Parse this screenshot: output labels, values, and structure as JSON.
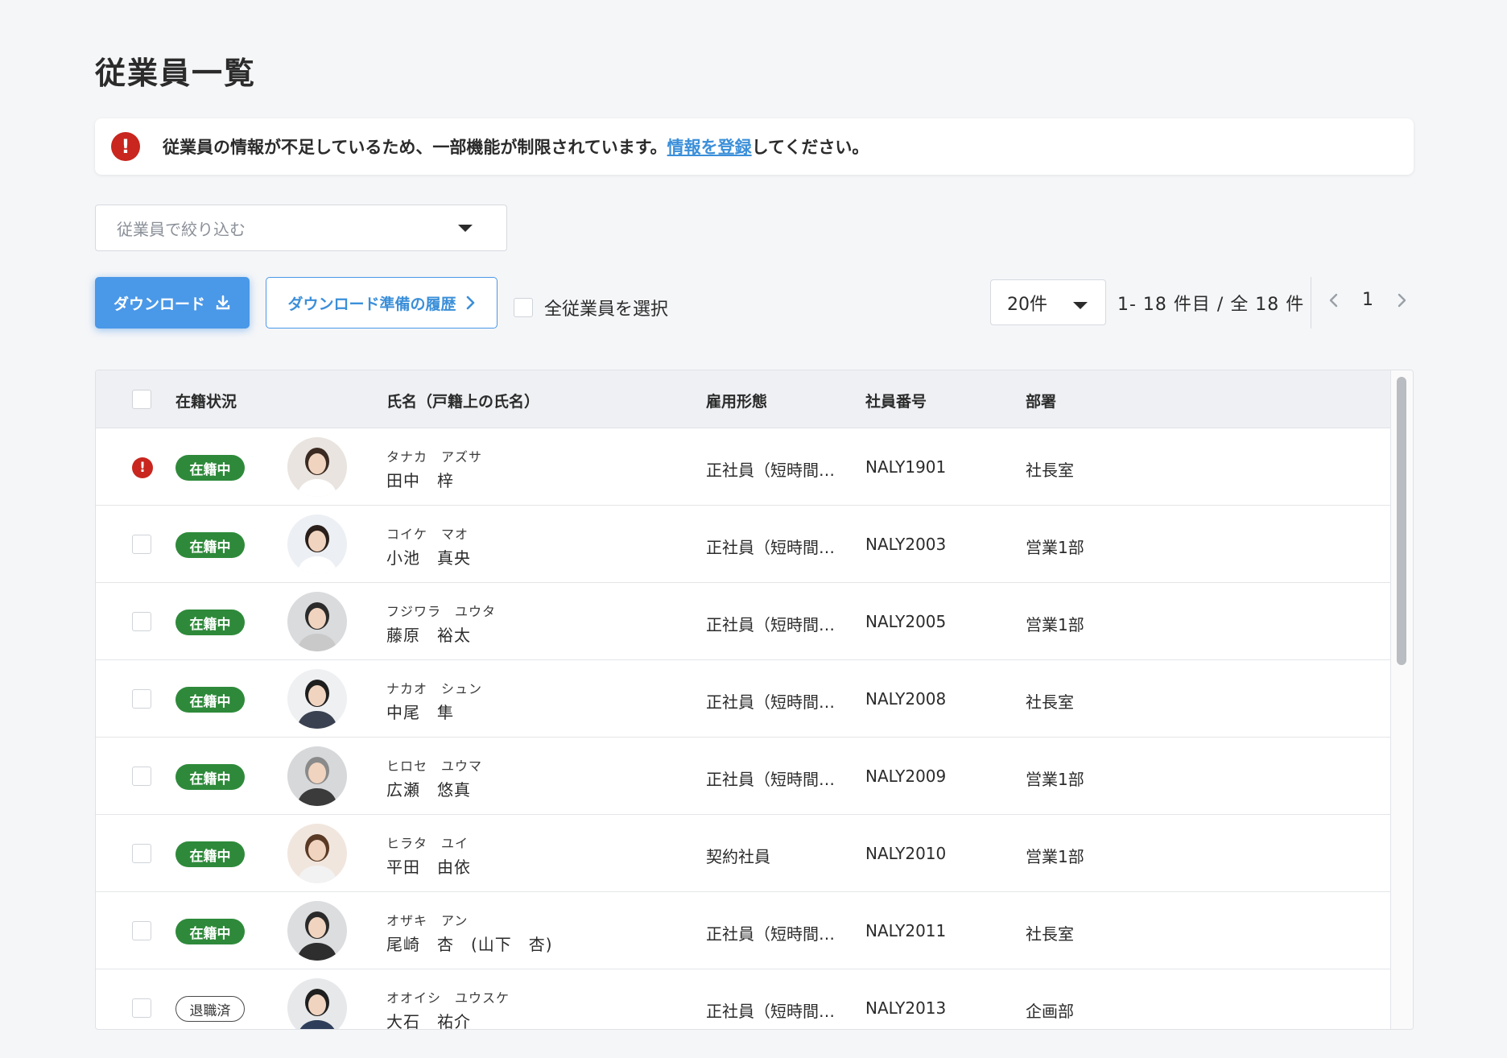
{
  "page_title": "従業員一覧",
  "alert": {
    "icon": "exclamation-icon",
    "text_before": "従業員の情報が不足しているため、一部機能が制限されています。",
    "link_text": "情報を登録",
    "text_after": "してください。"
  },
  "filter": {
    "placeholder": "従業員で絞り込む"
  },
  "toolbar": {
    "download_label": "ダウンロード",
    "history_label": "ダウンロード準備の履歴",
    "select_all_label": "全従業員を選択",
    "per_page": "20件",
    "range_text": "1- 18 件目 /  全 18 件",
    "current_page": "1"
  },
  "columns": {
    "status": "在籍状況",
    "name": "氏名（戸籍上の氏名）",
    "employment_type": "雇用形態",
    "employee_no": "社員番号",
    "department": "部署"
  },
  "rows": [
    {
      "status": "在籍中",
      "kana": "タナカ　アズサ",
      "name": "田中　梓",
      "employment_type": "正社員（短時間…",
      "employee_no": "NALY1901",
      "department": "社長室",
      "error": true
    },
    {
      "status": "在籍中",
      "kana": "コイケ　マオ",
      "name": "小池　真央",
      "employment_type": "正社員（短時間…",
      "employee_no": "NALY2003",
      "department": "営業1部",
      "error": false
    },
    {
      "status": "在籍中",
      "kana": "フジワラ　ユウタ",
      "name": "藤原　裕太",
      "employment_type": "正社員（短時間…",
      "employee_no": "NALY2005",
      "department": "営業1部",
      "error": false
    },
    {
      "status": "在籍中",
      "kana": "ナカオ　シュン",
      "name": "中尾　隼",
      "employment_type": "正社員（短時間…",
      "employee_no": "NALY2008",
      "department": "社長室",
      "error": false
    },
    {
      "status": "在籍中",
      "kana": "ヒロセ　ユウマ",
      "name": "広瀬　悠真",
      "employment_type": "正社員（短時間…",
      "employee_no": "NALY2009",
      "department": "営業1部",
      "error": false
    },
    {
      "status": "在籍中",
      "kana": "ヒラタ　ユイ",
      "name": "平田　由依",
      "employment_type": "契約社員",
      "employee_no": "NALY2010",
      "department": "営業1部",
      "error": false
    },
    {
      "status": "在籍中",
      "kana": "オザキ　アン",
      "name": "尾崎　杏　(山下　杏)",
      "employment_type": "正社員（短時間…",
      "employee_no": "NALY2011",
      "department": "社長室",
      "error": false
    },
    {
      "status": "退職済",
      "kana": "オオイシ　ユウスケ",
      "name": "大石　祐介",
      "employment_type": "正社員（短時間…",
      "employee_no": "NALY2013",
      "department": "企画部",
      "error": false
    }
  ],
  "colors": {
    "accent": "#4a98e8",
    "active_badge": "#2e8a3a",
    "error": "#c8261e"
  }
}
